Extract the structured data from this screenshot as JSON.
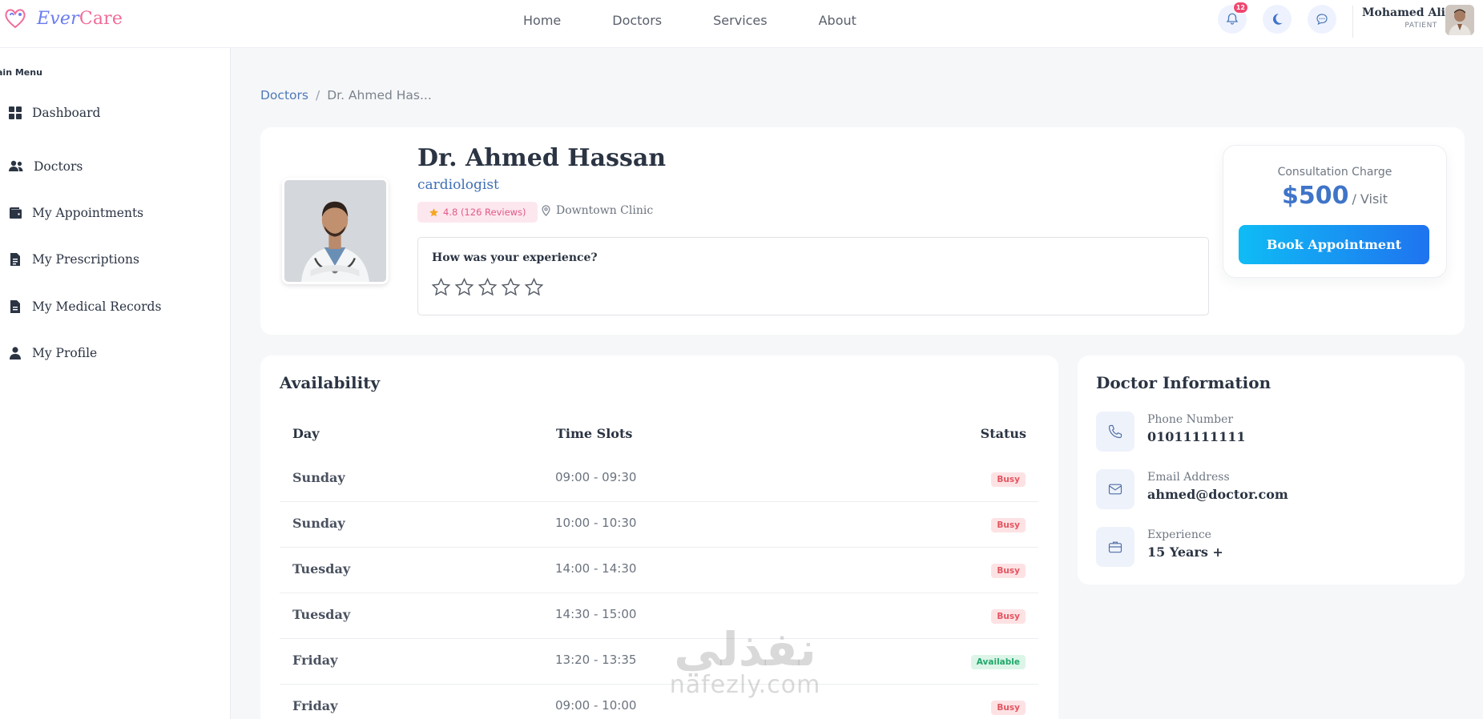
{
  "brand": {
    "part1": "Ever",
    "part2": "Care"
  },
  "nav": {
    "items": [
      "Home",
      "Doctors",
      "Services",
      "About"
    ]
  },
  "header": {
    "notification_count": "12",
    "user_name": "Mohamed Ali",
    "user_role": "PATIENT"
  },
  "sidebar": {
    "title": "ain Menu",
    "items": [
      {
        "label": "Dashboard",
        "icon": "grid-icon"
      },
      {
        "label": "Doctors",
        "icon": "users-icon"
      },
      {
        "label": "My Appointments",
        "icon": "wallet-icon"
      },
      {
        "label": "My Prescriptions",
        "icon": "file-icon"
      },
      {
        "label": "My Medical Records",
        "icon": "file-medical-icon"
      },
      {
        "label": "My Profile",
        "icon": "user-icon"
      }
    ]
  },
  "breadcrumb": {
    "parent": "Doctors",
    "separator": "/",
    "current": "Dr. Ahmed Has..."
  },
  "doctor": {
    "name": "Dr. Ahmed Hassan",
    "specialty": "cardiologist",
    "rating": "4.8 (126 Reviews)",
    "location": "Downtown Clinic",
    "experience_question": "How was your experience?",
    "user_rating": 0,
    "max_rating": 5
  },
  "consultation": {
    "label": "Consultation Charge",
    "price": "$500",
    "unit": "/ Visit",
    "book_label": "Book Appointment"
  },
  "availability": {
    "title": "Availability",
    "columns": [
      "Day",
      "Time Slots",
      "Status"
    ],
    "rows": [
      {
        "day": "Sunday",
        "time": "09:00 - 09:30",
        "status": "Busy"
      },
      {
        "day": "Sunday",
        "time": "10:00 - 10:30",
        "status": "Busy"
      },
      {
        "day": "Tuesday",
        "time": "14:00 - 14:30",
        "status": "Busy"
      },
      {
        "day": "Tuesday",
        "time": "14:30 - 15:00",
        "status": "Busy"
      },
      {
        "day": "Friday",
        "time": "13:20 - 13:35",
        "status": "Available"
      },
      {
        "day": "Friday",
        "time": "09:00 - 10:00",
        "status": "Busy"
      }
    ]
  },
  "info": {
    "title": "Doctor Information",
    "items": [
      {
        "label": "Phone Number",
        "value": "01011111111",
        "icon": "phone-icon"
      },
      {
        "label": "Email Address",
        "value": "ahmed@doctor.com",
        "icon": "envelope-icon"
      },
      {
        "label": "Experience",
        "value": "15 Years +",
        "icon": "briefcase-icon"
      }
    ]
  },
  "watermark": {
    "arabic": "نفذلي",
    "latin": "nafezly.com"
  },
  "colors": {
    "primary": "#3f74c8",
    "accent_pink": "#f06c9b",
    "busy": "#e25560",
    "available": "#1fa86a",
    "star": "#f5a623"
  }
}
